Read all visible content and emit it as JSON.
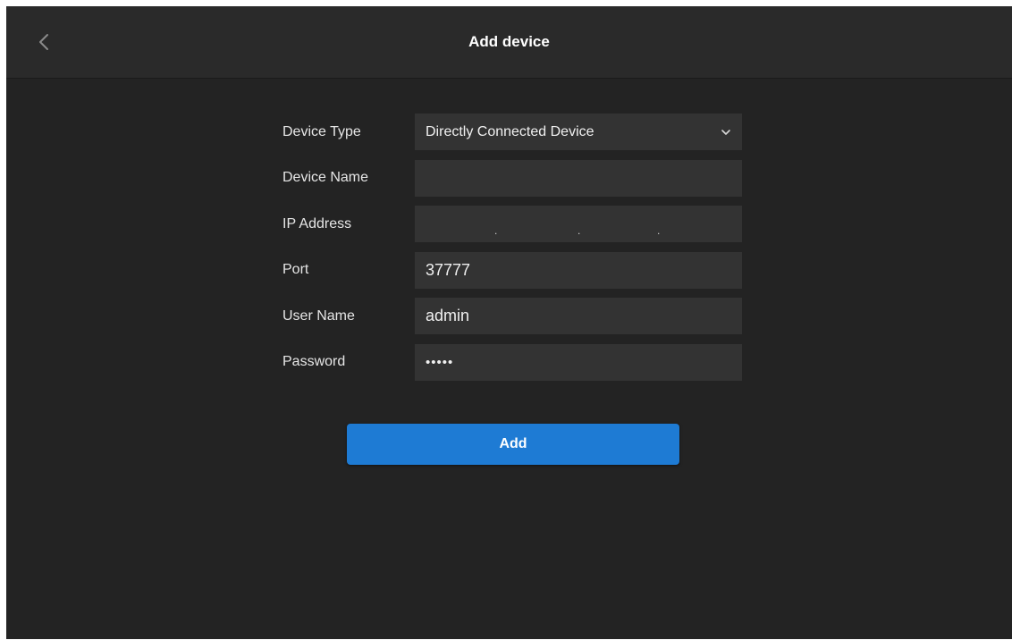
{
  "header": {
    "title": "Add device",
    "back_icon": "chevron-left-icon"
  },
  "form": {
    "device_type": {
      "label": "Device Type",
      "value": "Directly Connected Device",
      "icon": "chevron-down-icon"
    },
    "device_name": {
      "label": "Device Name",
      "value": ""
    },
    "ip_address": {
      "label": "IP Address",
      "value": "",
      "separators": [
        ".",
        ".",
        "."
      ]
    },
    "port": {
      "label": "Port",
      "value": "37777"
    },
    "user_name": {
      "label": "User Name",
      "value": "admin"
    },
    "password": {
      "label": "Password",
      "value": "•••••"
    }
  },
  "actions": {
    "add_label": "Add"
  },
  "colors": {
    "background": "#232323",
    "header": "#2a2a2a",
    "field": "#333333",
    "accent": "#1e7bd4"
  }
}
